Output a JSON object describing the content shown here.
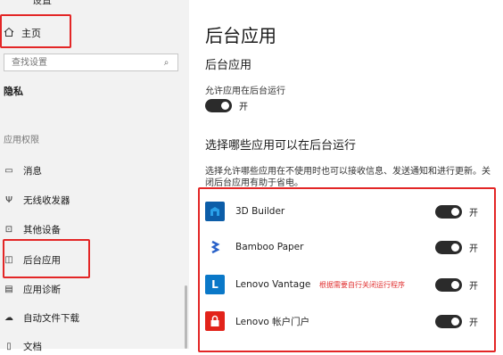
{
  "sidebar": {
    "top_cut": "设置",
    "home_label": "主页",
    "search_placeholder": "查找设置",
    "section_privacy": "隐私",
    "section_app_permissions": "应用权限",
    "items": [
      {
        "label": "消息",
        "icon": "message-icon"
      },
      {
        "label": "无线收发器",
        "icon": "radio-icon"
      },
      {
        "label": "其他设备",
        "icon": "devices-icon"
      },
      {
        "label": "后台应用",
        "icon": "background-apps-icon"
      },
      {
        "label": "应用诊断",
        "icon": "diagnostics-icon"
      },
      {
        "label": "自动文件下载",
        "icon": "cloud-icon"
      },
      {
        "label": "文档",
        "icon": "document-icon"
      }
    ]
  },
  "main": {
    "title": "后台应用",
    "subtitle": "后台应用",
    "allow_label": "允许应用在后台运行",
    "allow_state": "开",
    "choose_heading": "选择哪些应用可以在后台运行",
    "choose_desc": "选择允许哪些应用在不使用时也可以接收信息、发送通知和进行更新。关闭后台应用有助于省电。",
    "annotation": "根据需要自行关闭运行程序",
    "apps": [
      {
        "name": "3D Builder",
        "state": "开",
        "icon_color": "#0c5da8"
      },
      {
        "name": "Bamboo Paper",
        "state": "开",
        "icon_color": "#ffffff"
      },
      {
        "name": "Lenovo Vantage",
        "state": "开",
        "icon_color": "#0a78c8"
      },
      {
        "name": "Lenovo 帐户门户",
        "state": "开",
        "icon_color": "#e2231a"
      }
    ]
  }
}
